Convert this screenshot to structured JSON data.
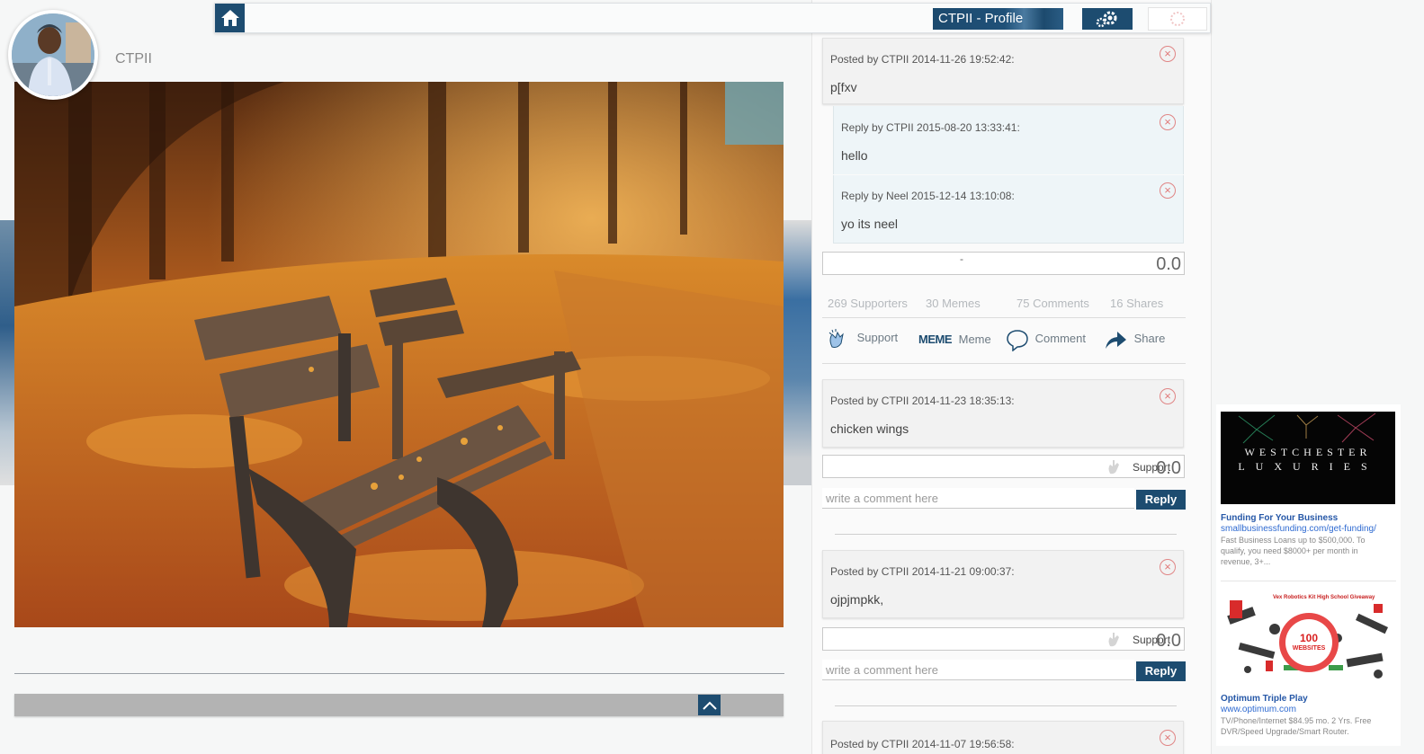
{
  "header": {
    "profile_label": "CTPII - Profile"
  },
  "profile": {
    "username": "CTPII"
  },
  "posts": [
    {
      "meta": "Posted by CTPII 2014-11-26 19:52:42:",
      "body": "p[fxv",
      "replies": [
        {
          "meta": "Reply by CTPII 2015-08-20 13:33:41:",
          "body": "hello"
        },
        {
          "meta": "Reply by Neel 2015-12-14 13:10:08:",
          "body": "yo its neel"
        }
      ],
      "rating": "0.0",
      "rating_dash": "-"
    },
    {
      "meta": "Posted by CTPII 2014-11-23 18:35:13:",
      "body": "chicken wings",
      "support_label": "Support",
      "support_value": "0.0",
      "comment_placeholder": "write a comment here",
      "reply_label": "Reply"
    },
    {
      "meta": "Posted by CTPII 2014-11-21 09:00:37:",
      "body": "ojpjmpkk,",
      "support_label": "Support",
      "support_value": "0.0",
      "comment_placeholder": "write a comment here",
      "reply_label": "Reply"
    },
    {
      "meta": "Posted by CTPII 2014-11-07 19:56:58:"
    }
  ],
  "stats": {
    "supporters": "269 Supporters",
    "memes": "30 Memes",
    "comments": "75 Comments",
    "shares": "16 Shares"
  },
  "actions": {
    "support": "Support",
    "meme_icon_text": "MEME",
    "meme": "Meme",
    "comment": "Comment",
    "share": "Share"
  },
  "ads": [
    {
      "image_line1": "WESTCHESTER",
      "image_line2": "LUXURIES",
      "title": "Funding For Your Business",
      "url": "smallbusinessfunding.com/get-funding/",
      "desc": "Fast Business Loans up to $500,000. To qualify, you need $8000+ per month in revenue, 3+..."
    },
    {
      "image_caption": "Vex Robotics Kit High School Giveaway",
      "image_badge_number": "100",
      "image_badge_text": "WEBSITES",
      "title": "Optimum Triple Play",
      "url": "www.optimum.com",
      "desc": "TV/Phone/Internet $84.95 mo. 2 Yrs. Free DVR/Speed Upgrade/Smart Router."
    }
  ],
  "colors": {
    "brand": "#1d4c70",
    "delete": "#e07a7a",
    "reply_bg": "#eef5f8"
  }
}
